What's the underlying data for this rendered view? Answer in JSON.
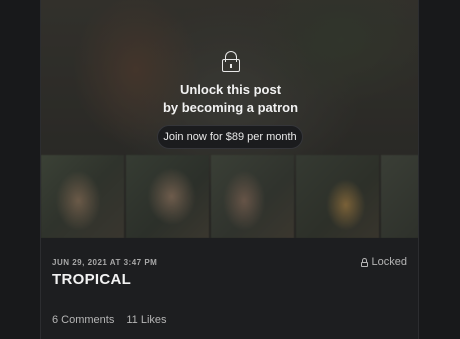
{
  "post": {
    "unlock_line1": "Unlock this post",
    "unlock_line2": "by becoming a patron",
    "join_label": "Join now for $89 per month",
    "date": "JUN 29, 2021 AT 3:47 PM",
    "locked_label": "Locked",
    "title": "TROPICAL",
    "comments": "6 Comments",
    "likes": "11 Likes"
  },
  "icons": [
    "lock-icon",
    "small-lock-icon"
  ],
  "colors": {
    "background": "#18191b",
    "card": "#1d1e20",
    "text": "#e6e6e6"
  }
}
